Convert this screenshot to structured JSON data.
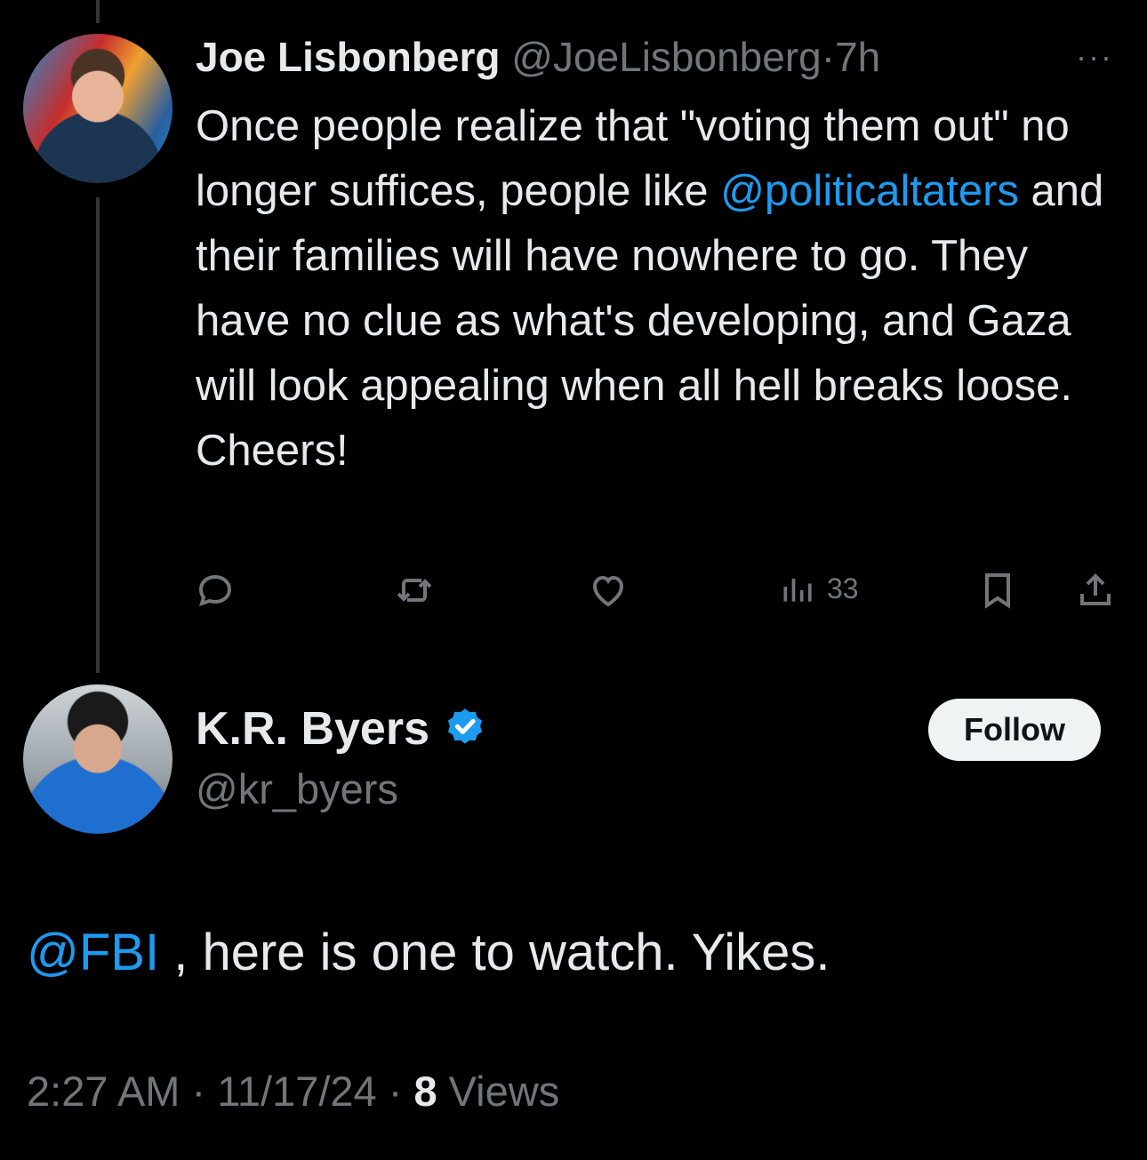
{
  "original_tweet": {
    "display_name": "Joe Lisbonberg",
    "handle": "@JoeLisbonberg",
    "separator": "·",
    "time": "7h",
    "more_label": "···",
    "text_parts": {
      "before_mention": "Once people realize that \"voting them out\" no longer suffices, people like ",
      "mention": "@politicaltaters",
      "after_mention": " and their families will have nowhere to go. They have no clue as what's developing, and Gaza will look appealing when all hell breaks loose. Cheers!"
    },
    "actions": {
      "reply_icon": "reply-icon",
      "retweet_icon": "retweet-icon",
      "like_icon": "like-icon",
      "views_icon": "views-icon",
      "views_count": "33",
      "bookmark_icon": "bookmark-icon",
      "share_icon": "share-icon"
    }
  },
  "reply_tweet": {
    "display_name": "K.R. Byers",
    "verified": true,
    "handle": "@kr_byers",
    "follow_label": "Follow",
    "text_parts": {
      "mention": "@FBI",
      "after_mention": " , here is one to watch. Yikes."
    },
    "meta": {
      "time": "2:27 AM",
      "separator": " · ",
      "date": "11/17/24",
      "views_count": "8",
      "views_label": " Views"
    }
  },
  "colors": {
    "background": "#000000",
    "text": "#e7e9ea",
    "muted": "#71767b",
    "link": "#1d9bf0",
    "verified": "#1d9bf0"
  }
}
